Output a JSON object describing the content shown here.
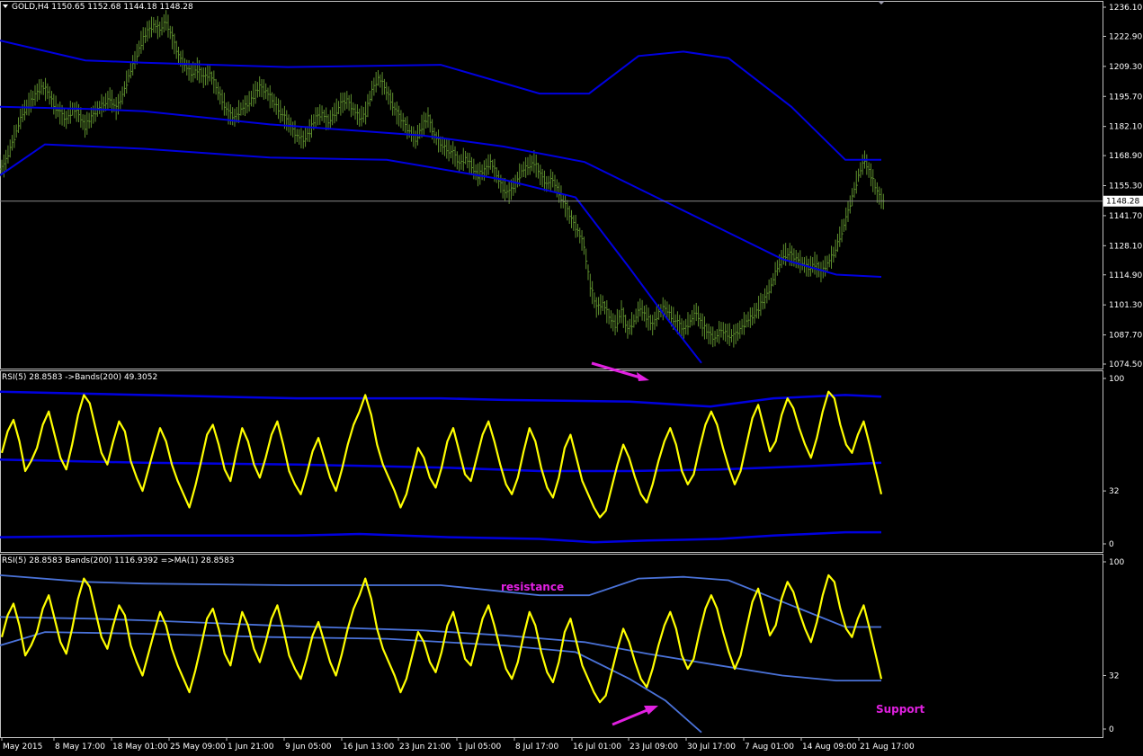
{
  "colors": {
    "background": "#000000",
    "frame": "#c0c0c0",
    "text": "#ffffff",
    "price_bars": "#5e8f2e",
    "bands_dark": "#0000e0",
    "bands_light": "#4a72d8",
    "rsi": "#ffff00",
    "annotation": "#e020e0",
    "price_line": "#8a8a8a"
  },
  "chart_data": [
    {
      "type": "bar",
      "panel": "price",
      "title": "GOLD,H4  1150.65 1152.68 1144.18 1148.28",
      "ylim": [
        1074.5,
        1236.1
      ],
      "y_ticks": [
        "1236.10",
        "1222.90",
        "1209.30",
        "1195.70",
        "1182.10",
        "1168.90",
        "1155.30",
        "1141.70",
        "1128.10",
        "1114.90",
        "1101.30",
        "1087.70",
        "1074.50"
      ],
      "current_price_label": "1148.28",
      "current_price": 1148.28,
      "price_close_series": [
        1164,
        1172,
        1180,
        1188,
        1192,
        1196,
        1200,
        1198,
        1192,
        1188,
        1185,
        1190,
        1188,
        1182,
        1186,
        1190,
        1192,
        1195,
        1190,
        1196,
        1205,
        1212,
        1220,
        1225,
        1228,
        1226,
        1230,
        1222,
        1214,
        1210,
        1206,
        1208,
        1204,
        1206,
        1200,
        1194,
        1188,
        1186,
        1190,
        1192,
        1196,
        1200,
        1198,
        1194,
        1190,
        1186,
        1182,
        1178,
        1176,
        1180,
        1186,
        1188,
        1184,
        1188,
        1192,
        1194,
        1190,
        1186,
        1188,
        1198,
        1204,
        1200,
        1194,
        1188,
        1184,
        1180,
        1176,
        1182,
        1186,
        1178,
        1174,
        1172,
        1170,
        1165,
        1168,
        1164,
        1160,
        1162,
        1166,
        1160,
        1154,
        1152,
        1156,
        1162,
        1164,
        1166,
        1160,
        1156,
        1158,
        1152,
        1146,
        1140,
        1135,
        1128,
        1110,
        1100,
        1102,
        1096,
        1092,
        1098,
        1090,
        1094,
        1100,
        1096,
        1092,
        1098,
        1100,
        1096,
        1093,
        1090,
        1094,
        1098,
        1092,
        1088,
        1086,
        1090,
        1088,
        1087,
        1090,
        1094,
        1096,
        1100,
        1104,
        1110,
        1118,
        1124,
        1124,
        1122,
        1120,
        1118,
        1120,
        1116,
        1120,
        1124,
        1132,
        1140,
        1150,
        1160,
        1167,
        1160,
        1152,
        1148
      ],
      "bands": {
        "upper": [
          [
            0,
            1221
          ],
          [
            95,
            1212
          ],
          [
            160,
            1211
          ],
          [
            320,
            1209
          ],
          [
            490,
            1210
          ],
          [
            600,
            1197
          ],
          [
            655,
            1197
          ],
          [
            710,
            1214
          ],
          [
            760,
            1216
          ],
          [
            810,
            1213
          ],
          [
            880,
            1191
          ],
          [
            940,
            1167
          ],
          [
            980,
            1167
          ]
        ],
        "middle": [
          [
            0,
            1191
          ],
          [
            100,
            1190
          ],
          [
            160,
            1189
          ],
          [
            300,
            1183
          ],
          [
            470,
            1178
          ],
          [
            560,
            1173
          ],
          [
            650,
            1166
          ],
          [
            720,
            1152
          ],
          [
            800,
            1136
          ],
          [
            870,
            1122
          ],
          [
            930,
            1115
          ],
          [
            980,
            1114
          ]
        ],
        "lower": [
          [
            0,
            1160
          ],
          [
            50,
            1174
          ],
          [
            160,
            1172
          ],
          [
            300,
            1168
          ],
          [
            430,
            1167
          ],
          [
            560,
            1158
          ],
          [
            640,
            1150
          ],
          [
            700,
            1118
          ],
          [
            740,
            1096
          ],
          [
            780,
            1075
          ]
        ]
      },
      "annotation_arrow": "down-right"
    },
    {
      "type": "line",
      "panel": "rsi1",
      "title": "RSI(5) 28.8583  ->Bands(200) 49.3052",
      "ylim": [
        0,
        100
      ],
      "y_ticks": [
        "100",
        "32",
        "0"
      ],
      "bands": {
        "upper": [
          [
            0,
            92
          ],
          [
            160,
            90
          ],
          [
            330,
            88
          ],
          [
            490,
            88
          ],
          [
            560,
            87
          ],
          [
            700,
            86
          ],
          [
            790,
            83
          ],
          [
            860,
            88
          ],
          [
            940,
            90
          ],
          [
            980,
            89
          ]
        ],
        "middle": [
          [
            0,
            51
          ],
          [
            160,
            49
          ],
          [
            330,
            48
          ],
          [
            500,
            46
          ],
          [
            600,
            44
          ],
          [
            700,
            44
          ],
          [
            800,
            45
          ],
          [
            900,
            47
          ],
          [
            980,
            49
          ]
        ],
        "lower": [
          [
            0,
            4
          ],
          [
            160,
            5
          ],
          [
            330,
            5
          ],
          [
            400,
            6
          ],
          [
            500,
            4
          ],
          [
            600,
            3
          ],
          [
            660,
            1
          ],
          [
            720,
            2
          ],
          [
            800,
            3
          ],
          [
            860,
            5
          ],
          [
            940,
            7
          ],
          [
            980,
            7
          ]
        ]
      },
      "annotation_arrow": "none"
    },
    {
      "type": "line",
      "panel": "rsi2",
      "title": "RSI(5) 28.8583  Bands(200) 1116.9392  =>MA(1) 28.8583",
      "ylim": [
        0,
        100
      ],
      "y_ticks": [
        "100",
        "32",
        "0"
      ],
      "bands": {
        "upper": [
          [
            0,
            92
          ],
          [
            95,
            88
          ],
          [
            160,
            87
          ],
          [
            320,
            86
          ],
          [
            490,
            86
          ],
          [
            600,
            80
          ],
          [
            655,
            80
          ],
          [
            710,
            90
          ],
          [
            760,
            91
          ],
          [
            810,
            89
          ],
          [
            880,
            74
          ],
          [
            940,
            61
          ],
          [
            980,
            61
          ]
        ],
        "middle": [
          [
            0,
            67
          ],
          [
            100,
            66
          ],
          [
            160,
            65
          ],
          [
            300,
            62
          ],
          [
            470,
            59
          ],
          [
            560,
            56
          ],
          [
            650,
            52
          ],
          [
            720,
            45
          ],
          [
            800,
            38
          ],
          [
            870,
            32
          ],
          [
            930,
            29
          ],
          [
            980,
            29
          ]
        ],
        "lower": [
          [
            0,
            50
          ],
          [
            50,
            58
          ],
          [
            160,
            57
          ],
          [
            300,
            55
          ],
          [
            430,
            54
          ],
          [
            560,
            50
          ],
          [
            640,
            46
          ],
          [
            700,
            30
          ],
          [
            740,
            17
          ],
          [
            780,
            -2
          ]
        ]
      },
      "annotations": [
        {
          "text": "resistance"
        },
        {
          "text": "Support"
        }
      ]
    }
  ],
  "rsi_series": [
    55,
    68,
    75,
    62,
    44,
    50,
    58,
    72,
    80,
    66,
    52,
    45,
    60,
    78,
    90,
    85,
    70,
    55,
    48,
    62,
    74,
    68,
    50,
    40,
    32,
    45,
    58,
    70,
    62,
    48,
    38,
    30,
    22,
    35,
    50,
    66,
    72,
    60,
    45,
    38,
    55,
    70,
    62,
    48,
    40,
    52,
    66,
    74,
    60,
    44,
    36,
    30,
    42,
    56,
    64,
    52,
    40,
    32,
    45,
    60,
    72,
    80,
    90,
    78,
    60,
    48,
    40,
    32,
    22,
    30,
    44,
    58,
    52,
    40,
    34,
    46,
    62,
    70,
    56,
    42,
    38,
    52,
    66,
    74,
    62,
    48,
    36,
    30,
    40,
    56,
    70,
    62,
    46,
    34,
    28,
    40,
    58,
    66,
    52,
    38,
    30,
    22,
    16,
    20,
    34,
    48,
    60,
    52,
    40,
    30,
    25,
    36,
    50,
    62,
    70,
    60,
    44,
    36,
    42,
    58,
    72,
    80,
    72,
    58,
    46,
    36,
    44,
    60,
    76,
    84,
    70,
    56,
    62,
    78,
    88,
    82,
    70,
    60,
    52,
    64,
    80,
    92,
    88,
    72,
    60,
    55,
    66,
    74,
    60,
    45,
    30
  ],
  "x_axis": {
    "labels": [
      "May 2015",
      "8 May 17:00",
      "18 May 01:00",
      "25 May 09:00",
      "1 Jun 21:00",
      "9 Jun 05:00",
      "16 Jun 13:00",
      "23 Jun 21:00",
      "1 Jul 05:00",
      "8 Jul 17:00",
      "16 Jul 01:00",
      "23 Jul 09:00",
      "30 Jul 17:00",
      "7 Aug 01:00",
      "14 Aug 09:00",
      "21 Aug 17:00"
    ]
  }
}
